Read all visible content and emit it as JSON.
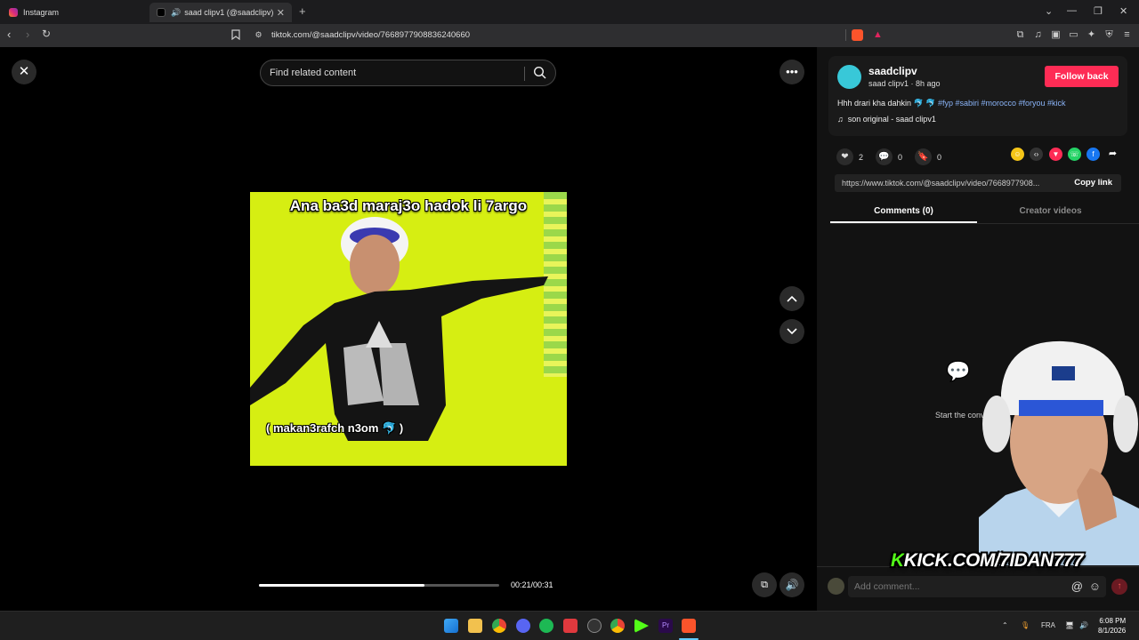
{
  "browser": {
    "tabs": [
      {
        "title": "Instagram",
        "active": false
      },
      {
        "title": "saad clipv1 (@saadclipv) | Tik",
        "active": true
      }
    ],
    "url": "tiktok.com/@saadclipv/video/7668977908836240660"
  },
  "search": {
    "placeholder": "Find related content"
  },
  "video": {
    "caption_top": "Ana ba3d maraj3o hadok li 7argo",
    "caption_bottom": "( makan3rafch n3om 🐬 )",
    "time": "00:21/00:31",
    "progress": 0.69
  },
  "creator": {
    "username": "saadclipv",
    "subline": "saad clipv1 · 8h ago",
    "follow_label": "Follow back",
    "description_text": "Hhh drari kha dahkin 🐬 🐬 ",
    "hashtags": "#fyp #sabiri #morocco #foryou #kick",
    "music": "son original - saad clipv1"
  },
  "stats": {
    "likes": "2",
    "comments": "0",
    "saves": "0"
  },
  "link": {
    "url": "https://www.tiktok.com/@saadclipv/video/7668977908...",
    "copy_label": "Copy link"
  },
  "tabs": {
    "comments": "Comments (0)",
    "creator": "Creator videos"
  },
  "empty_state": "Start the conv",
  "comment_input": {
    "placeholder": "Add comment..."
  },
  "overlay": {
    "kick_k": "K",
    "kick_text": "KICK.COM/7IDAN777"
  },
  "system": {
    "lang": "FRA",
    "time": "6:08 PM",
    "date": "8/1/2026"
  },
  "colors": {
    "accent": "#fe2c55",
    "video_bg": "#d6ee12",
    "kick_green": "#53fc18"
  }
}
